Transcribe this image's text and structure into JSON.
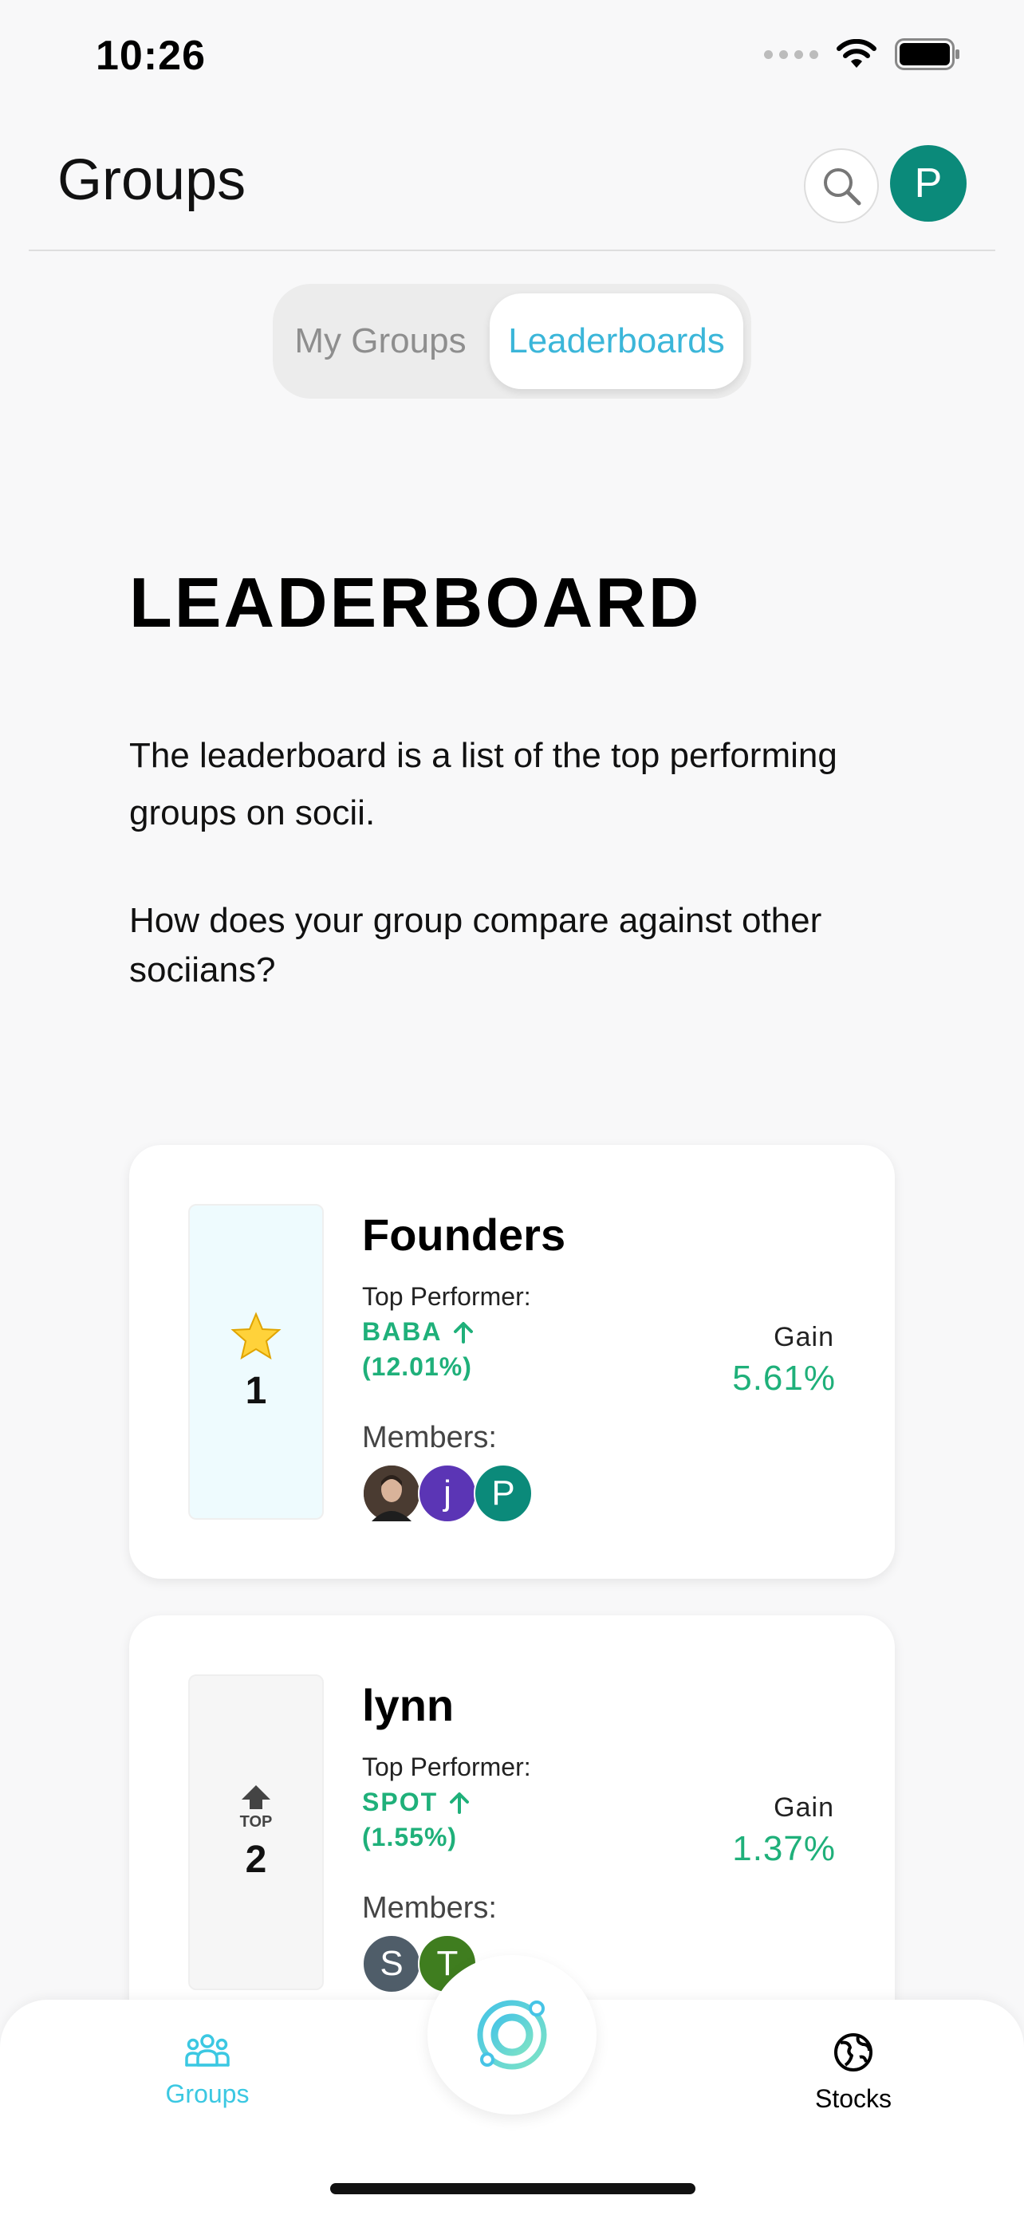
{
  "status_bar": {
    "time": "10:26"
  },
  "header": {
    "title": "Groups",
    "avatar_initial": "P"
  },
  "tabs": {
    "inactive": "My Groups",
    "active": "Leaderboards"
  },
  "leaderboard": {
    "title": "LEADERBOARD",
    "description": "The leaderboard is a list of the top performing groups on socii.",
    "question": "How does your group compare against other sociians?"
  },
  "cards": [
    {
      "rank": "1",
      "rank_icon": "star-icon",
      "name": "Founders",
      "top_performer_label": "Top Performer:",
      "ticker": "BABA",
      "ticker_change": "(12.01%)",
      "members_label": "Members:",
      "members": [
        {
          "initial": "",
          "color": "#5a4a3e",
          "type": "photo"
        },
        {
          "initial": "j",
          "color": "#5b35b5"
        },
        {
          "initial": "P",
          "color": "#0b8a7a"
        }
      ],
      "gain_label": "Gain",
      "gain_value": "5.61%"
    },
    {
      "rank": "2",
      "rank_icon": "top-arrow-icon",
      "rank_icon_text": "TOP",
      "name": "lynn",
      "top_performer_label": "Top Performer:",
      "ticker": "SPOT",
      "ticker_change": "(1.55%)",
      "members_label": "Members:",
      "members": [
        {
          "initial": "S",
          "color": "#4f5d69"
        },
        {
          "initial": "T",
          "color": "#3f7d1f"
        }
      ],
      "gain_label": "Gain",
      "gain_value": "1.37%"
    }
  ],
  "bottom_nav": {
    "groups_label": "Groups",
    "stocks_label": "Stocks"
  },
  "colors": {
    "accent": "#3bb6d9",
    "gain_green": "#1fb07a",
    "avatar_teal": "#0b8a7a"
  }
}
